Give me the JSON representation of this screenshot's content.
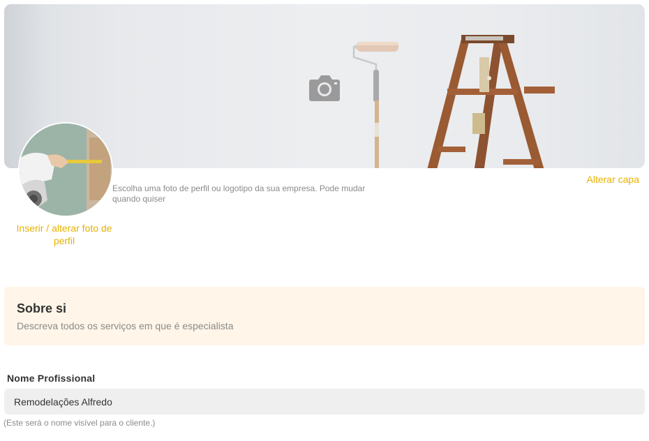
{
  "cover": {
    "camera_icon": "camera-icon",
    "change_cover_label": "Alterar capa"
  },
  "profile": {
    "hint": "Escolha uma foto de perfil ou logotipo da sua empresa. Pode mudar quando quiser",
    "change_photo_label": "Inserir / alterar foto de perfil"
  },
  "about": {
    "title": "Sobre si",
    "subtitle": "Descreva todos os serviços em que é especialista"
  },
  "professional_name": {
    "label": "Nome Profissional",
    "value": "Remodelações Alfredo",
    "help": "(Este será o nome visível para o cliente.)"
  },
  "colors": {
    "accent": "#e6b100",
    "about_bg": "#fff5e8",
    "input_bg": "#efefef"
  }
}
